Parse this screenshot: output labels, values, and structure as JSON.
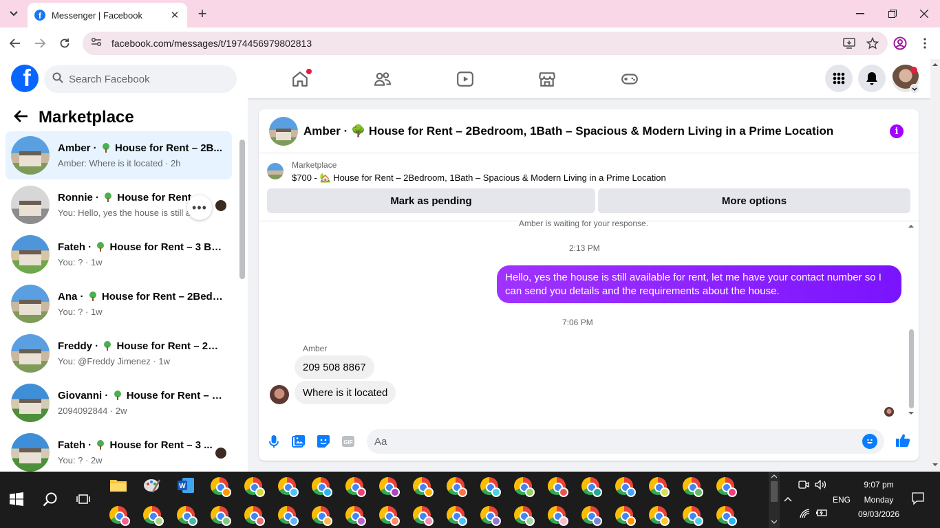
{
  "browser": {
    "tab_title": "Messenger | Facebook",
    "url": "facebook.com/messages/t/1974456979802813"
  },
  "fb": {
    "search_placeholder": "Search Facebook"
  },
  "sidebar": {
    "title": "Marketplace",
    "conversations": [
      {
        "name": "Amber",
        "listing": "House for Rent – 2B...",
        "preview": "Amber: Where is it located · 2h",
        "active": true
      },
      {
        "name": "Ronnie",
        "listing": "House for Rent –",
        "preview": "You: Hello, yes the house is still a..."
      },
      {
        "name": "Fateh",
        "listing": "House for Rent – 3 Be...",
        "preview": "You: ? · 1w"
      },
      {
        "name": "Ana",
        "listing": "House for Rent – 2Bedr...",
        "preview": "You: ? · 1w"
      },
      {
        "name": "Freddy",
        "listing": "House for Rent – 2B...",
        "preview": "You: @Freddy Jimenez · 1w"
      },
      {
        "name": "Giovanni",
        "listing": "House for Rent – 3...",
        "preview": "2094092844 · 2w"
      },
      {
        "name": "Fateh",
        "listing": "House for Rent – 3 ...",
        "preview": "You: ? · 2w"
      }
    ]
  },
  "chat": {
    "header_title": "Amber · 🌳 House for Rent – 2Bedroom, 1Bath – Spacious & Modern Living in a Prime Location",
    "listing_label": "Marketplace",
    "listing_desc": "$700 - 🏡 House for Rent – 2Bedroom, 1Bath – Spacious & Modern Living in a Prime Location",
    "btn_pending": "Mark as pending",
    "btn_more": "More options",
    "system_msg": "Amber is waiting for your response.",
    "time1": "2:13 PM",
    "outgoing": "Hello, yes the house is still available for rent, let me have your contact number so I can send you details and the requirements about the house.",
    "time2": "7:06 PM",
    "sender": "Amber",
    "incoming1": "209 508 8867",
    "incoming2": "Where is it located",
    "composer_placeholder": "Aa"
  },
  "taskbar": {
    "time": "9:07 pm",
    "day": "Monday",
    "date": "09/03/2026",
    "lang": "ENG"
  },
  "colors": {
    "fb_blue": "#0866ff",
    "messenger_purple": "#8a00ff",
    "active_row": "#e7f3ff"
  }
}
